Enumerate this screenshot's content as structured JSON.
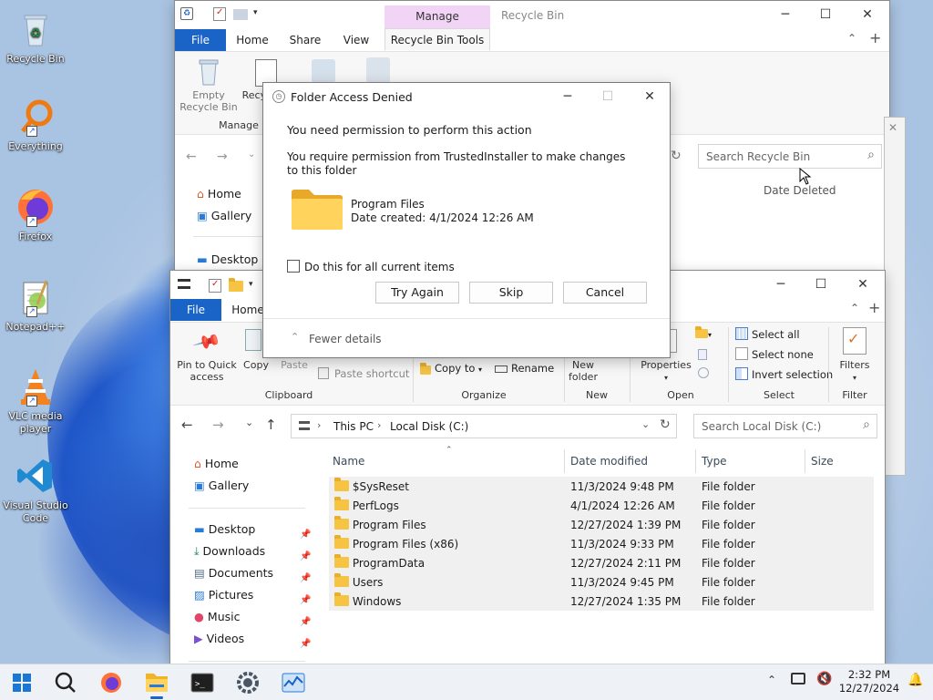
{
  "desktop": {
    "icons": [
      {
        "label": "Recycle Bin",
        "icon": "recycle-bin-icon"
      },
      {
        "label": "Everything",
        "icon": "everything-search-icon"
      },
      {
        "label": "Firefox",
        "icon": "firefox-icon"
      },
      {
        "label": "Notepad++",
        "icon": "notepad-plus-plus-icon"
      },
      {
        "label": "VLC media player",
        "icon": "vlc-icon"
      },
      {
        "label": "Visual Studio Code",
        "icon": "vscode-icon"
      }
    ]
  },
  "recycle_window": {
    "manage_tab": "Manage",
    "title": "Recycle Bin",
    "tabs": [
      "File",
      "Home",
      "Share",
      "View",
      "Recycle Bin Tools"
    ],
    "ribbon": {
      "empty_bin": "Empty Recycle Bin",
      "properties": "Recycle Bin properties",
      "group": "Manage"
    },
    "search_placeholder": "Search Recycle Bin",
    "nav": [
      "Home",
      "Gallery",
      "Desktop"
    ],
    "column_date_deleted": "Date Deleted"
  },
  "dialog": {
    "title": "Folder Access Denied",
    "heading": "You need permission to perform this action",
    "message": "You require permission from TrustedInstaller to make changes to this folder",
    "item_name": "Program Files",
    "item_created": "Date created: 4/1/2024 12:26 AM",
    "checkbox_label": "Do this for all current items",
    "checkbox_checked": false,
    "buttons": {
      "try_again": "Try Again",
      "skip": "Skip",
      "cancel": "Cancel"
    },
    "details_toggle": "Fewer details"
  },
  "explorer": {
    "tabs": [
      "File",
      "Home"
    ],
    "ribbon": {
      "pin": "Pin to Quick access",
      "copy": "Copy",
      "paste": "Paste",
      "paste_shortcut": "Paste shortcut",
      "copy_to": "Copy to",
      "rename": "Rename",
      "new_folder": "New folder",
      "properties": "Properties",
      "select_all": "Select all",
      "select_none": "Select none",
      "invert_selection": "Invert selection",
      "filters": "Filters",
      "groups": [
        "Clipboard",
        "Organize",
        "New",
        "Open",
        "Select",
        "Filter"
      ]
    },
    "breadcrumb": [
      "This PC",
      "Local Disk (C:)"
    ],
    "search_placeholder": "Search Local Disk (C:)",
    "nav": [
      {
        "label": "Home",
        "icon": "home-icon",
        "pinned": false
      },
      {
        "label": "Gallery",
        "icon": "gallery-icon",
        "pinned": false
      },
      {
        "label": "Desktop",
        "icon": "desktop-icon",
        "pinned": true
      },
      {
        "label": "Downloads",
        "icon": "downloads-icon",
        "pinned": true
      },
      {
        "label": "Documents",
        "icon": "documents-icon",
        "pinned": true
      },
      {
        "label": "Pictures",
        "icon": "pictures-icon",
        "pinned": true
      },
      {
        "label": "Music",
        "icon": "music-icon",
        "pinned": true
      },
      {
        "label": "Videos",
        "icon": "videos-icon",
        "pinned": true
      }
    ],
    "columns": [
      "Name",
      "Date modified",
      "Type",
      "Size"
    ],
    "rows": [
      {
        "name": "$SysReset",
        "date": "11/3/2024 9:48 PM",
        "type": "File folder"
      },
      {
        "name": "PerfLogs",
        "date": "4/1/2024 12:26 AM",
        "type": "File folder"
      },
      {
        "name": "Program Files",
        "date": "12/27/2024 1:39 PM",
        "type": "File folder"
      },
      {
        "name": "Program Files (x86)",
        "date": "11/3/2024 9:33 PM",
        "type": "File folder"
      },
      {
        "name": "ProgramData",
        "date": "12/27/2024 2:11 PM",
        "type": "File folder"
      },
      {
        "name": "Users",
        "date": "11/3/2024 9:45 PM",
        "type": "File folder"
      },
      {
        "name": "Windows",
        "date": "12/27/2024 1:35 PM",
        "type": "File folder"
      }
    ]
  },
  "taskbar": {
    "apps": [
      "start-icon",
      "search-icon",
      "firefox-icon",
      "file-explorer-icon",
      "terminal-icon",
      "settings-icon",
      "task-manager-icon"
    ],
    "time": "2:32 PM",
    "date": "12/27/2024"
  },
  "colors": {
    "accent": "#1a63c7",
    "manage_tab": "#f2d4f6",
    "folder": "#f6c343",
    "row_highlight": "#f0f0f0"
  }
}
